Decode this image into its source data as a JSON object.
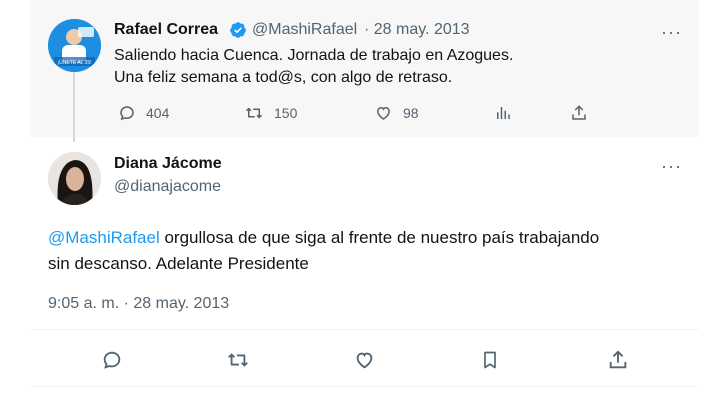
{
  "quoted_tweet": {
    "author_name": "Rafael Correa",
    "handle": "@MashiRafael",
    "date": "· 28 may. 2013",
    "line1": "Saliendo hacia Cuenca. Jornada de trabajo en Azogues.",
    "line2": "Una feliz semana a  tod@s, con algo de retraso.",
    "more_label": "···",
    "replies": "404",
    "retweets": "150",
    "likes": "98",
    "avatar_badge": "¡ÚNETE AL 35!"
  },
  "reply_tweet": {
    "author_name": "Diana Jácome",
    "handle": "@dianajacome",
    "mention": "@MashiRafael",
    "text_rest": " orgullosa de que siga al frente de nuestro país trabajando",
    "line2": "sin descanso. Adelante Presidente",
    "timestamp": "9:05 a. m. · 28 may. 2013",
    "more_label": "···"
  },
  "colors": {
    "accent": "#1d9bf0",
    "muted": "#536471",
    "verified": "#1d9bf0",
    "card_bg": "#f7f7f7"
  }
}
